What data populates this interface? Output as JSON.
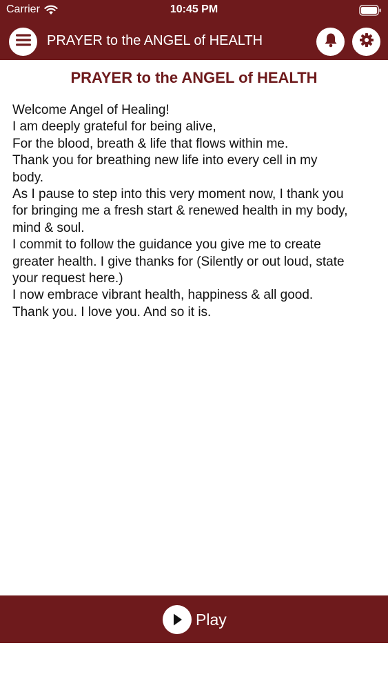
{
  "status_bar": {
    "carrier": "Carrier",
    "time": "10:45 PM",
    "icons": [
      "wifi-icon",
      "battery-icon"
    ]
  },
  "nav": {
    "title": "PRAYER to the ANGEL of HEALTH",
    "menu_icon": "menu-icon",
    "bell_icon": "bell-icon",
    "settings_icon": "gear-icon"
  },
  "content": {
    "title": "PRAYER to the ANGEL of HEALTH",
    "lines": [
      "Welcome Angel of Healing!",
      "I am deeply grateful for being alive,",
      "For the blood, breath & life that flows within me.",
      "Thank you for breathing new life into every cell in my",
      "body.",
      "As I pause to step into this very moment now, I thank you",
      "for bringing me a fresh start & renewed health in my body,",
      "mind & soul.",
      "I commit to follow the guidance you give me to create",
      "greater health. I give thanks for (Silently or out loud, state",
      "your request here.)",
      "I now embrace vibrant health, happiness & all good.",
      "Thank you. I love you. And so it is."
    ]
  },
  "bottom_bar": {
    "play_label": "Play",
    "play_icon": "play-icon"
  },
  "colors": {
    "brand": "#6e1a1c",
    "text": "#111111",
    "background": "#ffffff"
  }
}
